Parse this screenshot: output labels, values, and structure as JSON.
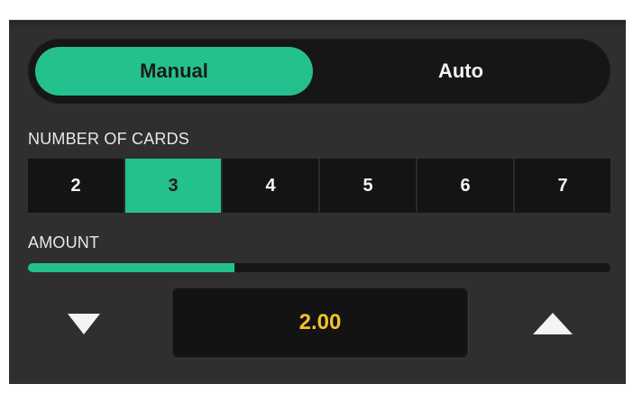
{
  "mode_toggle": {
    "options": [
      {
        "label": "Manual",
        "selected": true
      },
      {
        "label": "Auto",
        "selected": false
      }
    ]
  },
  "cards": {
    "label": "NUMBER OF CARDS",
    "options": [
      "2",
      "3",
      "4",
      "5",
      "6",
      "7"
    ],
    "selected": "3"
  },
  "amount": {
    "label": "AMOUNT",
    "value": "2.00",
    "slider_fraction": 0.355,
    "decrease_icon": "triangle-down-icon",
    "increase_icon": "triangle-up-icon"
  },
  "colors": {
    "accent": "#24c18f",
    "value": "#f2c12e",
    "panel": "#2f2f2f",
    "control_bg": "#141414"
  }
}
